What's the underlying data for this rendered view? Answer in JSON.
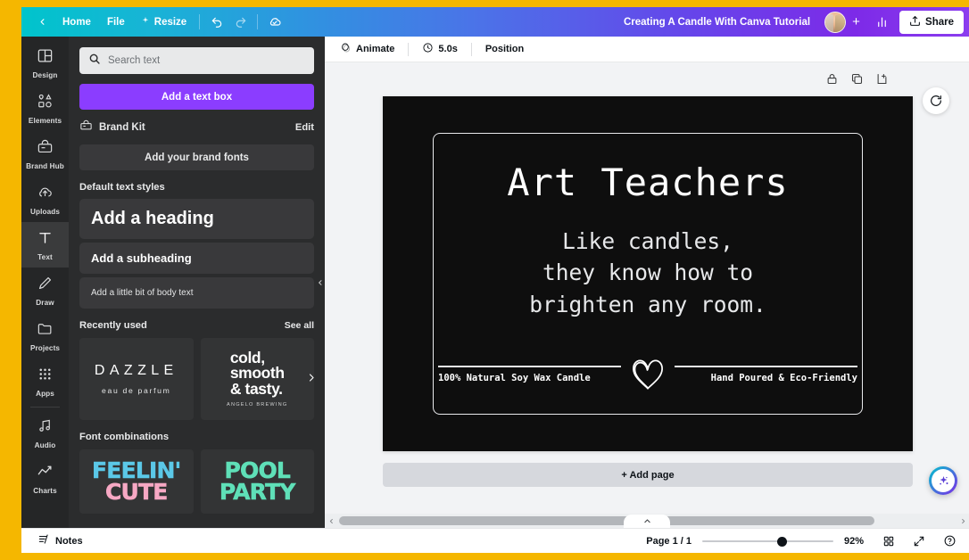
{
  "header": {
    "back_icon": "chevron-left-icon",
    "home": "Home",
    "file": "File",
    "resize": "Resize",
    "undo_icon": "undo-icon",
    "redo_icon": "redo-icon",
    "cloud_icon": "cloud-saved-icon",
    "doc_title": "Creating A Candle With Canva Tutorial",
    "avatar": "avatar",
    "add_member": "+",
    "insights_icon": "insights-bar-chart-icon",
    "share_icon": "share-upload-icon",
    "share": "Share",
    "gradient_start": "#00c4cc",
    "gradient_end": "#7d2ae8"
  },
  "rail": {
    "items": [
      {
        "label": "Design",
        "icon": "design-layout-icon",
        "active": false
      },
      {
        "label": "Elements",
        "icon": "elements-shapes-icon",
        "active": false
      },
      {
        "label": "Brand Hub",
        "icon": "brand-hub-icon",
        "active": false
      },
      {
        "label": "Uploads",
        "icon": "upload-cloud-icon",
        "active": false
      },
      {
        "label": "Text",
        "icon": "text-t-icon",
        "active": true
      },
      {
        "label": "Draw",
        "icon": "draw-pen-icon",
        "active": false
      },
      {
        "label": "Projects",
        "icon": "folder-icon",
        "active": false
      },
      {
        "label": "Apps",
        "icon": "apps-grid-icon",
        "active": false
      },
      {
        "label": "Audio",
        "icon": "audio-note-icon",
        "active": false
      },
      {
        "label": "Charts",
        "icon": "charts-line-icon",
        "active": false
      }
    ]
  },
  "panel": {
    "search_placeholder": "Search text",
    "search_value": "",
    "search_icon": "search-icon",
    "add_text_box": "Add a text box",
    "brand_kit_icon": "brand-kit-icon",
    "brand_kit": "Brand Kit",
    "brand_kit_edit": "Edit",
    "add_brand_fonts": "Add your brand fonts",
    "default_styles_title": "Default text styles",
    "style_heading": "Add a heading",
    "style_subheading": "Add a subheading",
    "style_body": "Add a little bit of body text",
    "recently_used_title": "Recently used",
    "recently_used_see_all": "See all",
    "recent_cards": [
      {
        "top": "DAZZLE",
        "sub": "eau de parfum"
      },
      {
        "line1": "cold,",
        "line2": "smooth",
        "line3": "& tasty.",
        "sub": "ANGELO BREWING"
      }
    ],
    "recent_next_icon": "chevron-right-icon",
    "font_combinations_title": "Font combinations",
    "combo_cards": [
      {
        "line1": "FEELIN'",
        "line2": "CUTE",
        "color1": "#5bc8e8",
        "color2": "#f7a8c4"
      },
      {
        "line1": "POOL",
        "line2": "PARTY",
        "color1": "#5fe0b8",
        "color2": "#5fe0b8"
      }
    ],
    "collapse_icon": "chevron-left-icon"
  },
  "editor": {
    "toolbar": {
      "animate_icon": "animate-icon",
      "animate": "Animate",
      "timer_icon": "clock-icon",
      "duration": "5.0s",
      "position": "Position"
    },
    "page_tools": [
      {
        "icon": "lock-icon"
      },
      {
        "icon": "duplicate-icon"
      },
      {
        "icon": "add-to-folder-icon"
      }
    ],
    "refresh_icon": "refresh-magic-icon",
    "design": {
      "title": "Art Teachers",
      "subtitle_line1": "Like candles,",
      "subtitle_line2": "they know how to",
      "subtitle_line3": "brighten any room.",
      "footer_left": "100% Natural Soy Wax Candle",
      "footer_right": "Hand Poured & Eco-Friendly",
      "heart_icon": "hand-drawn-heart-icon",
      "background": "#0e0e0e",
      "foreground": "#ffffff"
    },
    "add_page": "+ Add page",
    "scroll_left_icon": "chevron-left-icon",
    "scroll_right_icon": "chevron-right-icon",
    "collapse_panel_icon": "chevron-up-icon"
  },
  "statusbar": {
    "notes_icon": "notes-icon",
    "notes": "Notes",
    "page_count": "Page 1 / 1",
    "zoom_percent": "92%",
    "grid_icon": "grid-view-icon",
    "fullscreen_icon": "fullscreen-icon",
    "help_icon": "help-circle-icon"
  },
  "ai": {
    "icon": "magic-sparkles-icon"
  }
}
